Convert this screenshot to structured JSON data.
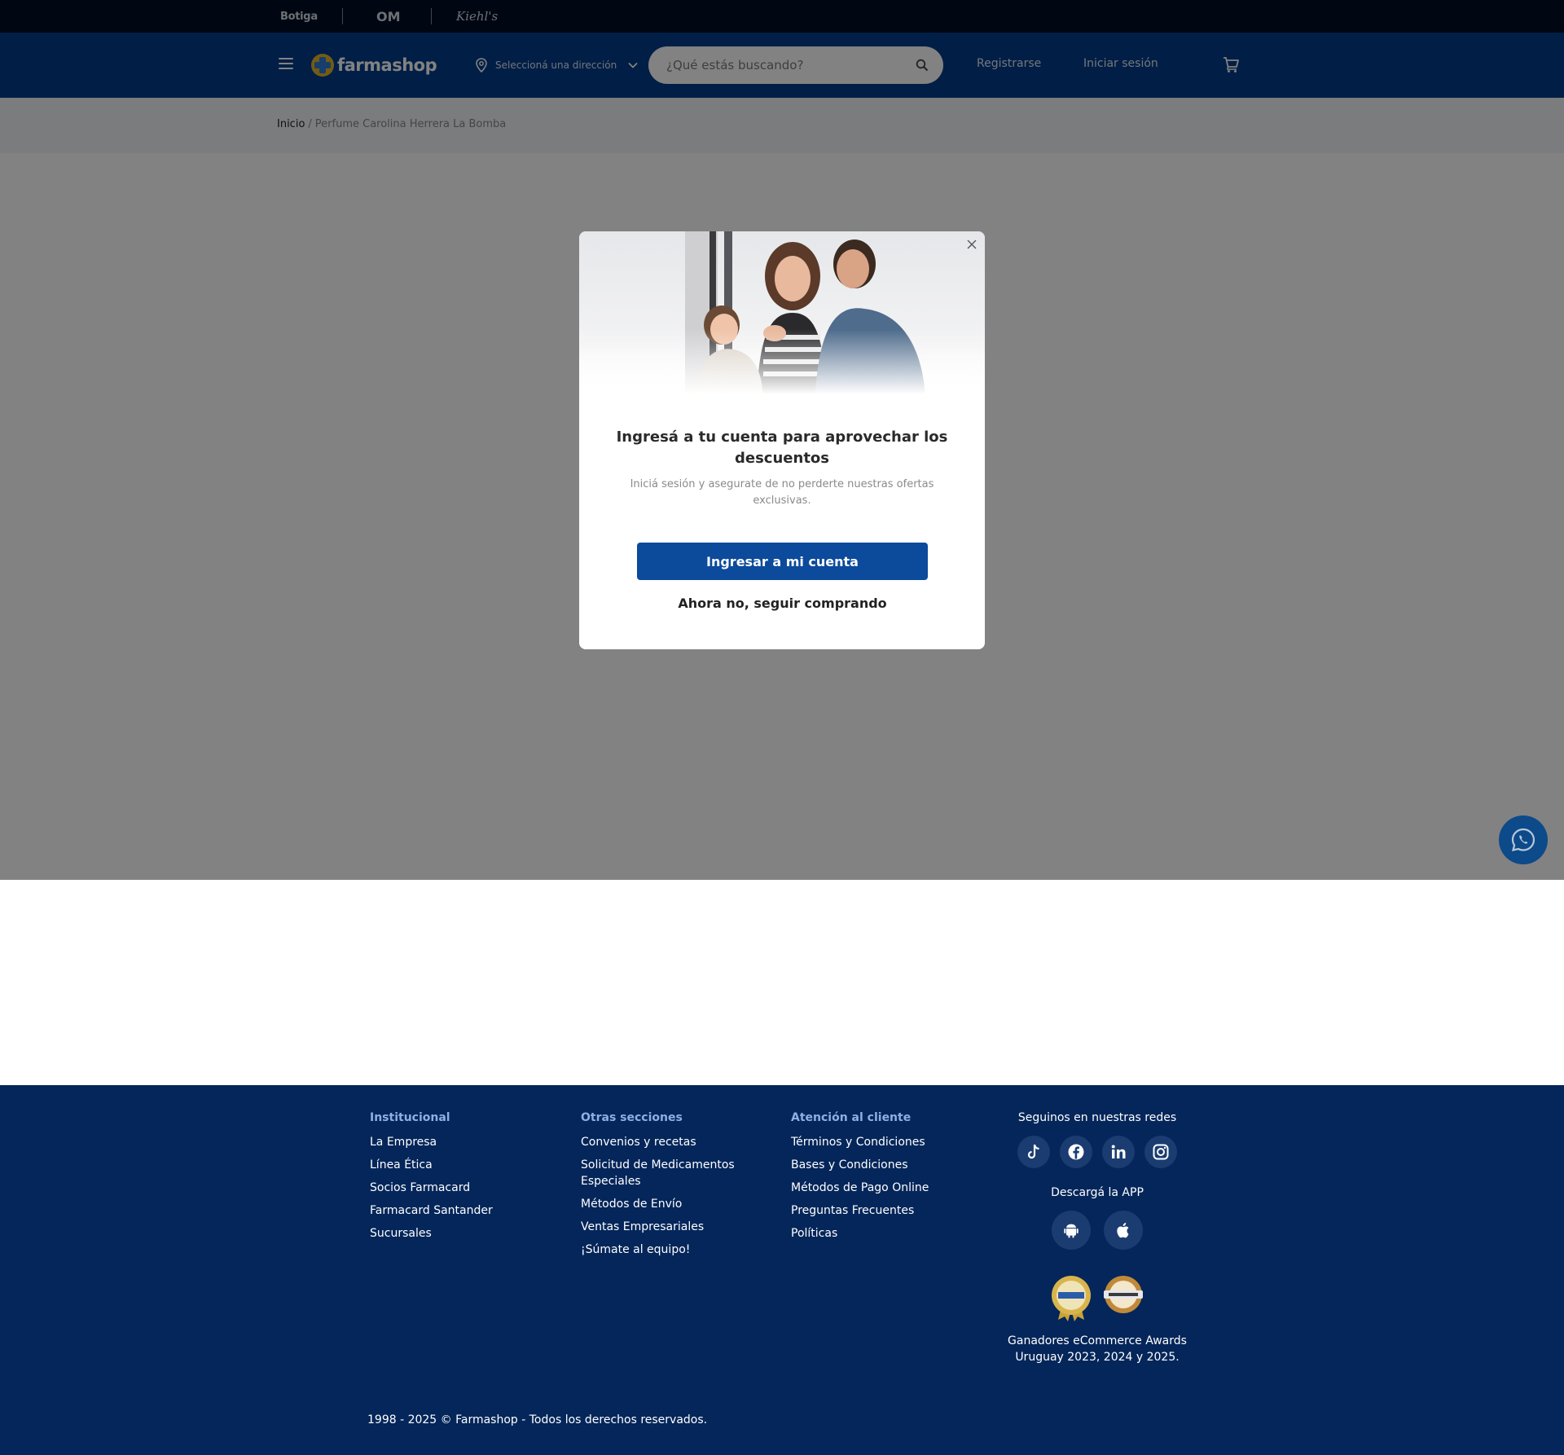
{
  "top_strip": {
    "brands": [
      "Botiga",
      "OM",
      "Kiehl's"
    ]
  },
  "header": {
    "logo_text": "farmashop",
    "address_label": "Seleccioná una dirección",
    "search_placeholder": "¿Qué estás buscando?",
    "register_label": "Registrarse",
    "login_label": "Iniciar sesión"
  },
  "breadcrumb": {
    "home": "Inicio",
    "separator": "/",
    "current": "Perfume Carolina Herrera La Bomba"
  },
  "modal": {
    "title": "Ingresá a tu cuenta para aprovechar los descuentos ",
    "subtitle": "Iniciá sesión y asegurate de no perderte nuestras ofertas exclusivas. ",
    "primary_button": "Ingresar a mi cuenta",
    "secondary_button": "Ahora no, seguir comprando"
  },
  "footer": {
    "columns": [
      {
        "title": "Institucional",
        "links": [
          "La Empresa",
          "Línea Ética",
          "Socios Farmacard",
          "Farmacard Santander",
          "Sucursales"
        ]
      },
      {
        "title": "Otras secciones",
        "links": [
          "Convenios y recetas",
          "Solicitud de Medicamentos Especiales",
          "Métodos de Envío",
          "Ventas Empresariales",
          "¡Súmate al equipo!"
        ]
      },
      {
        "title": "Atención al cliente",
        "links": [
          "Términos y Condiciones",
          "Bases y Condiciones",
          "Métodos de Pago Online",
          "Preguntas Frecuentes",
          "Políticas"
        ]
      }
    ],
    "social_title": "Seguinos en nuestras redes",
    "social_icons": [
      "tiktok-icon",
      "facebook-icon",
      "linkedin-icon",
      "instagram-icon"
    ],
    "app_title": "Descargá la APP",
    "app_icons": [
      "android-icon",
      "apple-icon"
    ],
    "awards_text": "Ganadores eCommerce Awards Uruguay 2023, 2024 y 2025.",
    "copyright": "1998 - 2025 © Farmashop - Todos los derechos reservados."
  },
  "colors": {
    "header_bg": "#003c8a",
    "top_strip_bg": "#000e27",
    "footer_bg": "#04265a",
    "primary_button": "#0c4a9c",
    "logo_yellow": "#e2b227"
  }
}
